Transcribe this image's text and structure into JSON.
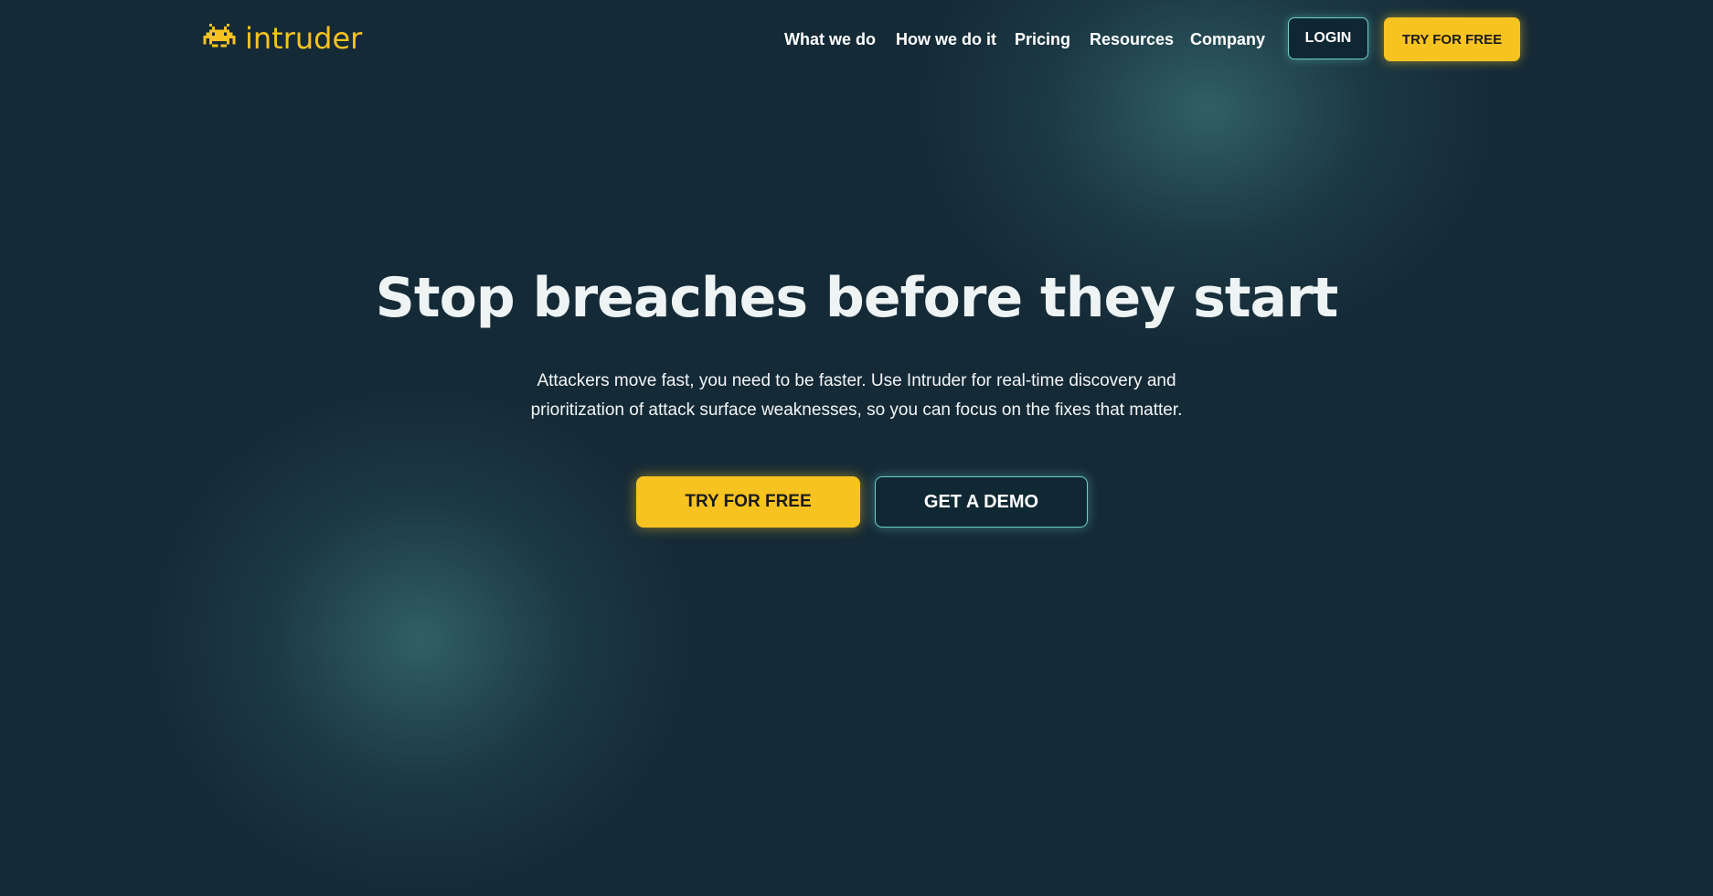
{
  "brand": {
    "name": "intruder",
    "icon": "space-invader-icon",
    "color": "#f7c321"
  },
  "nav": {
    "items": [
      {
        "label": "What we do"
      },
      {
        "label": "How we do it"
      },
      {
        "label": "Pricing"
      },
      {
        "label": "Resources"
      },
      {
        "label": "Company"
      }
    ],
    "login_label": "LOGIN",
    "try_label": "TRY FOR FREE"
  },
  "hero": {
    "title": "Stop breaches before they start",
    "subtitle_line1": "Attackers move fast, you need to be faster. Use Intruder for real-time discovery and",
    "subtitle_line2": "prioritization of attack surface weaknesses, so you can focus on the fixes that matter.",
    "primary_cta": "TRY FOR FREE",
    "secondary_cta": "GET A DEMO"
  },
  "colors": {
    "background": "#152a37",
    "accent_yellow": "#f7c321",
    "accent_teal": "#6ad1c6",
    "glow": "#2f5d62"
  }
}
